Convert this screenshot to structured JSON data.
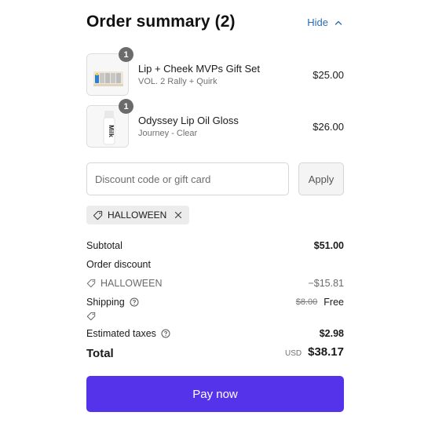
{
  "header": {
    "title": "Order summary (2)",
    "toggle_label": "Hide"
  },
  "items": [
    {
      "quantity": "1",
      "name": "Lip + Cheek MVPs Gift Set",
      "variant": "VOL. 2 Rally + Quirk",
      "price": "$25.00",
      "thumb_icon": "gift-set-product-image"
    },
    {
      "quantity": "1",
      "name": "Odyssey Lip Oil Gloss",
      "variant": "Journey - Clear",
      "price": "$26.00",
      "thumb_icon": "lip-gloss-product-image",
      "thumb_label": "Milk"
    }
  ],
  "discount": {
    "placeholder": "Discount code or gift card",
    "apply_label": "Apply"
  },
  "applied_code": "HALLOWEEN",
  "summary": {
    "subtotal_label": "Subtotal",
    "subtotal_value": "$51.00",
    "order_discount_label": "Order discount",
    "discount_code": "HALLOWEEN",
    "discount_value": "−$15.81",
    "shipping_label": "Shipping",
    "shipping_original": "$8.00",
    "shipping_value": "Free",
    "taxes_label": "Estimated taxes",
    "taxes_value": "$2.98",
    "total_label": "Total",
    "currency": "USD",
    "total_value": "$38.17"
  },
  "pay_label": "Pay now",
  "colors": {
    "accent": "#5433eb",
    "link": "#2a6bb5",
    "badge": "#6b6b6b"
  }
}
